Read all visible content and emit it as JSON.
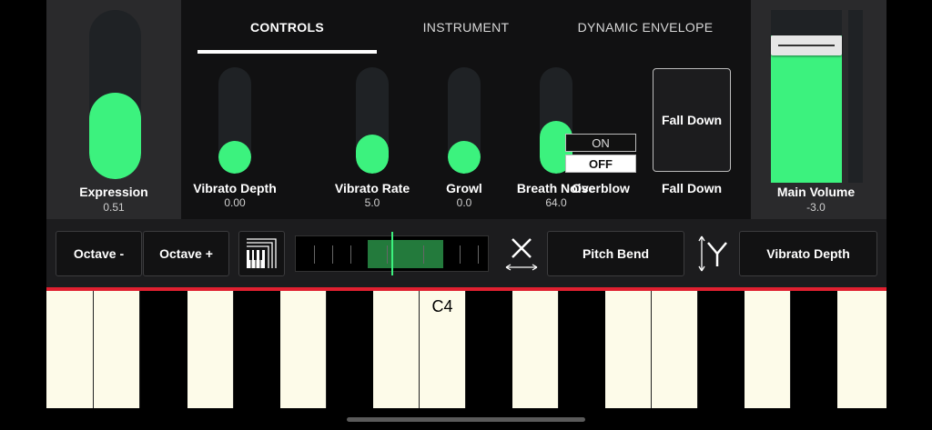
{
  "tabs": [
    {
      "label": "CONTROLS",
      "active": true
    },
    {
      "label": "INSTRUMENT",
      "active": false
    },
    {
      "label": "DYNAMIC ENVELOPE",
      "active": false
    }
  ],
  "expression": {
    "label": "Expression",
    "value": "0.51",
    "level": 0.51
  },
  "sliders": [
    {
      "label": "Vibrato Depth",
      "value": "0.00",
      "level": 0.0
    },
    {
      "label": "Vibrato Rate",
      "value": "5.0",
      "level": 0.1
    },
    {
      "label": "Growl",
      "value": "0.0",
      "level": 0.0
    },
    {
      "label": "Breath Noise",
      "value": "64.0",
      "level": 0.5
    }
  ],
  "overblow": {
    "label": "Overblow",
    "on_label": "ON",
    "off_label": "OFF",
    "selected": "OFF"
  },
  "fall": {
    "button_label": "Fall Down",
    "label": "Fall Down"
  },
  "main_volume": {
    "label": "Main Volume",
    "value": "-3.0",
    "level": 0.84
  },
  "toolbar": {
    "octave_down": "Octave -",
    "octave_up": "Octave +",
    "x_axis_label": "Pitch Bend",
    "y_axis_label": "Vibrato Depth"
  },
  "keyboard": {
    "marker_label": "C4"
  },
  "colors": {
    "accent": "#3cf27e",
    "keyboard_line": "#e02030"
  }
}
